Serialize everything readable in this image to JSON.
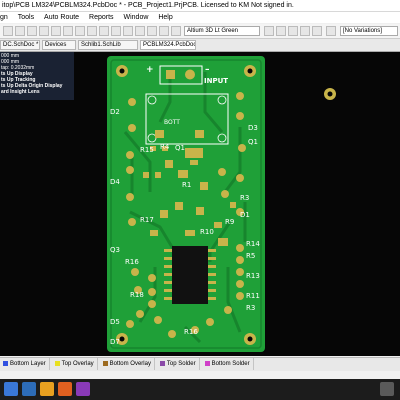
{
  "window": {
    "title": "itop\\PCB LM324\\PCBLM324.PcbDoc * - PCB_Project1.PrjPCB. Licensed to  KM  Not signed in."
  },
  "menu": [
    "gn",
    "Tools",
    "Auto Route",
    "Reports",
    "Window",
    "Help"
  ],
  "toolbar": {
    "style_combo": "Altium 3D Lt Green",
    "variant_combo": "[No Variations]"
  },
  "tabs": [
    {
      "label": "DC.SchDoc *"
    },
    {
      "label": "Devices"
    },
    {
      "label": "Schlib1.SchLib"
    },
    {
      "label": "PCBLM324.PcbDoc *"
    }
  ],
  "hud": {
    "lines": [
      "000 mm",
      "000 mm",
      "tap: 0.2032mm",
      "ts Up Display",
      "ts Up Tracking",
      "ts Up Delta Origin Display",
      "ard Insight Lens"
    ]
  },
  "pcb": {
    "silk": {
      "plus": "+",
      "minus": "–",
      "input": "INPUT",
      "batt": "BOTT",
      "designators": [
        "D2",
        "D3",
        "Q1",
        "R15",
        "R4",
        "Q1",
        "D4",
        "R1",
        "R3",
        "R17",
        "R10",
        "R9",
        "D1",
        "Q3",
        "R16",
        "R18",
        "R14",
        "R5",
        "R13",
        "R11",
        "R3",
        "D5",
        "R16",
        "D7"
      ]
    }
  },
  "layers": [
    {
      "label": "Bottom Layer",
      "color": "#3050e0"
    },
    {
      "label": "Top Overlay",
      "color": "#e8e020"
    },
    {
      "label": "Bottom Overlay",
      "color": "#9c6a20"
    },
    {
      "label": "Top Solder",
      "color": "#8a4aa8"
    },
    {
      "label": "Bottom Solder",
      "color": "#d040c8"
    }
  ],
  "colors": {
    "board": "#1fa038",
    "board_dark": "#17852d",
    "pad": "#c8b44a",
    "silk": "#ffffff",
    "canvas": "#060606"
  }
}
